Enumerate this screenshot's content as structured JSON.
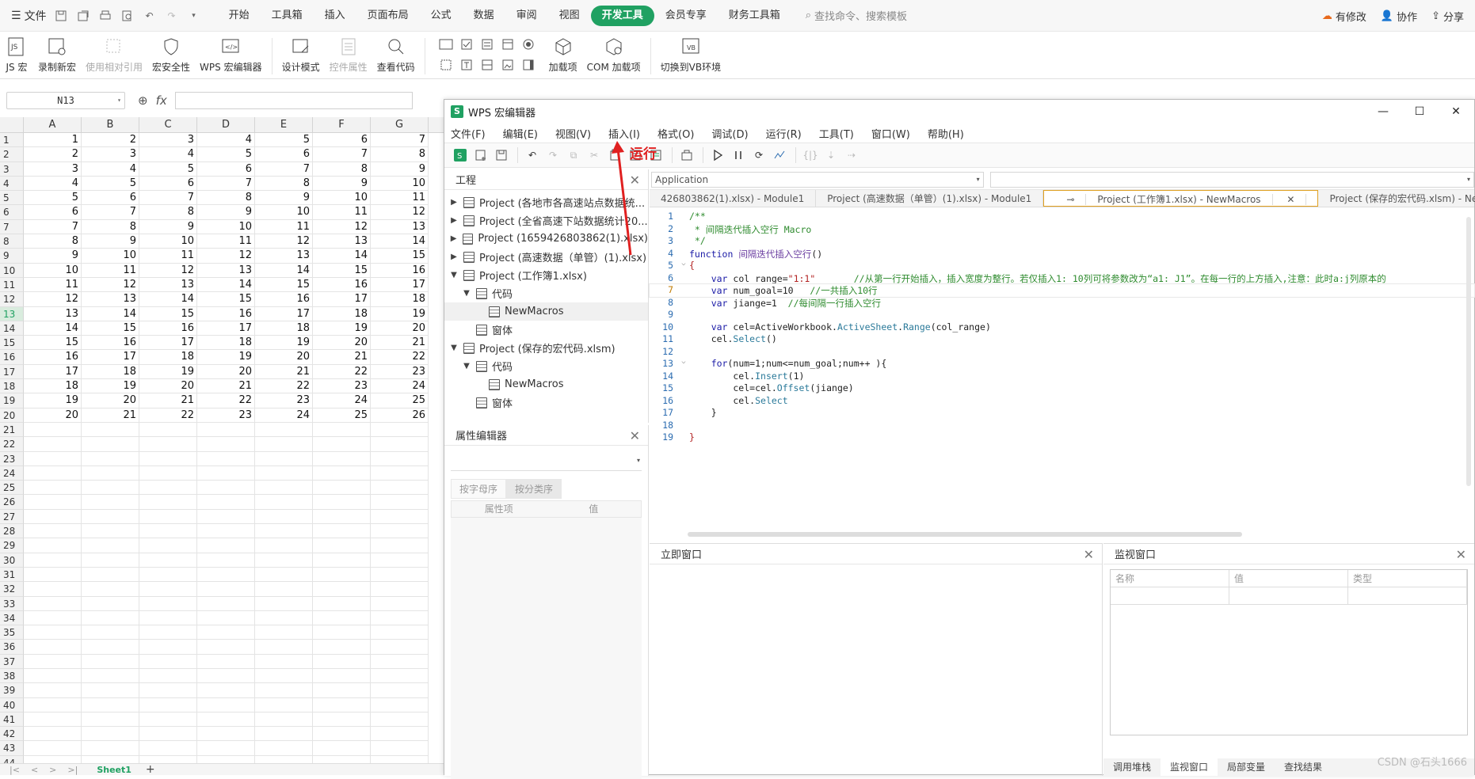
{
  "menubar": {
    "file_label": "文件",
    "tabs": [
      "开始",
      "工具箱",
      "插入",
      "页面布局",
      "公式",
      "数据",
      "审阅",
      "视图",
      "开发工具",
      "会员专享",
      "财务工具箱"
    ],
    "active_tab": "开发工具",
    "search_placeholder": "查找命令、搜索模板",
    "right": {
      "changes": "有修改",
      "collab": "协作",
      "share": "分享"
    }
  },
  "ribbon": {
    "buttons": [
      {
        "label": "JS 宏",
        "icon": "js-macro-icon",
        "enabled": true
      },
      {
        "label": "录制新宏",
        "icon": "record-macro-icon",
        "enabled": true
      },
      {
        "label": "使用相对引用",
        "icon": "relative-ref-icon",
        "enabled": false
      },
      {
        "label": "宏安全性",
        "icon": "macro-security-icon",
        "enabled": true
      },
      {
        "label": "WPS 宏编辑器",
        "icon": "macro-editor-icon",
        "enabled": true
      },
      {
        "label": "设计模式",
        "icon": "design-mode-icon",
        "enabled": true
      },
      {
        "label": "控件属性",
        "icon": "control-props-icon",
        "enabled": false
      },
      {
        "label": "查看代码",
        "icon": "view-code-icon",
        "enabled": true
      },
      {
        "label": "加载项",
        "icon": "addins-icon",
        "enabled": true
      },
      {
        "label": "COM 加载项",
        "icon": "com-addins-icon",
        "enabled": true
      },
      {
        "label": "切换到VB环境",
        "icon": "switch-vb-icon",
        "enabled": true
      }
    ]
  },
  "formula_bar": {
    "cell_ref": "N13",
    "fx": "fx"
  },
  "sheet": {
    "columns": [
      "A",
      "B",
      "C",
      "D",
      "E",
      "F",
      "G"
    ],
    "row_count": 44,
    "selected_row": 13,
    "data_rows": 20,
    "sheet_tab": "Sheet1"
  },
  "editor": {
    "title": "WPS 宏编辑器",
    "menu": [
      "文件(F)",
      "编辑(E)",
      "视图(V)",
      "插入(I)",
      "格式(O)",
      "调试(D)",
      "运行(R)",
      "工具(T)",
      "窗口(W)",
      "帮助(H)"
    ],
    "project_pane": {
      "title": "工程",
      "nodes": [
        {
          "label": "Project (各地市各高速站点数据统...",
          "level": 0,
          "arrow": "▶"
        },
        {
          "label": "Project (全省高速下站数据统计20...",
          "level": 0,
          "arrow": "▶"
        },
        {
          "label": "Project (1659426803862(1).xlsx)",
          "level": 0,
          "arrow": "▶"
        },
        {
          "label": "Project (高速数据（单管）(1).xlsx)",
          "level": 0,
          "arrow": "▶"
        },
        {
          "label": "Project (工作簿1.xlsx)",
          "level": 0,
          "arrow": "▼"
        },
        {
          "label": "代码",
          "level": 1,
          "arrow": "▼"
        },
        {
          "label": "NewMacros",
          "level": 2,
          "arrow": ""
        },
        {
          "label": "窗体",
          "level": 1,
          "arrow": ""
        },
        {
          "label": "Project (保存的宏代码.xlsm)",
          "level": 0,
          "arrow": "▼"
        },
        {
          "label": "代码",
          "level": 1,
          "arrow": "▼"
        },
        {
          "label": "NewMacros",
          "level": 2,
          "arrow": ""
        },
        {
          "label": "窗体",
          "level": 1,
          "arrow": ""
        }
      ]
    },
    "props_pane": {
      "title": "属性编辑器",
      "tabs": [
        "按字母序",
        "按分类序"
      ],
      "cols": [
        "属性项",
        "值"
      ]
    },
    "combo_left": "Application",
    "file_tabs": [
      "426803862(1).xlsx) - Module1",
      "Project (高速数据（单管）(1).xlsx) - Module1",
      "Project (工作簿1.xlsx) - NewMacros",
      "Project (保存的宏代码.xlsm) - NewMacros"
    ],
    "active_file_tab": 2,
    "immediate_title": "立即窗口",
    "watch_title": "监视窗口",
    "watch_cols": [
      "名称",
      "值",
      "类型"
    ],
    "bottom_tabs": [
      "调用堆栈",
      "监视窗口",
      "局部变量",
      "查找结果"
    ],
    "active_bottom_tab": 1
  },
  "annotation": {
    "text": "运行",
    "color": "#e02020"
  },
  "watermark": "CSDN @石头1666",
  "colors": {
    "accent": "#20a162",
    "annotation": "#e02020",
    "active_tab_border": "#e0a020"
  }
}
